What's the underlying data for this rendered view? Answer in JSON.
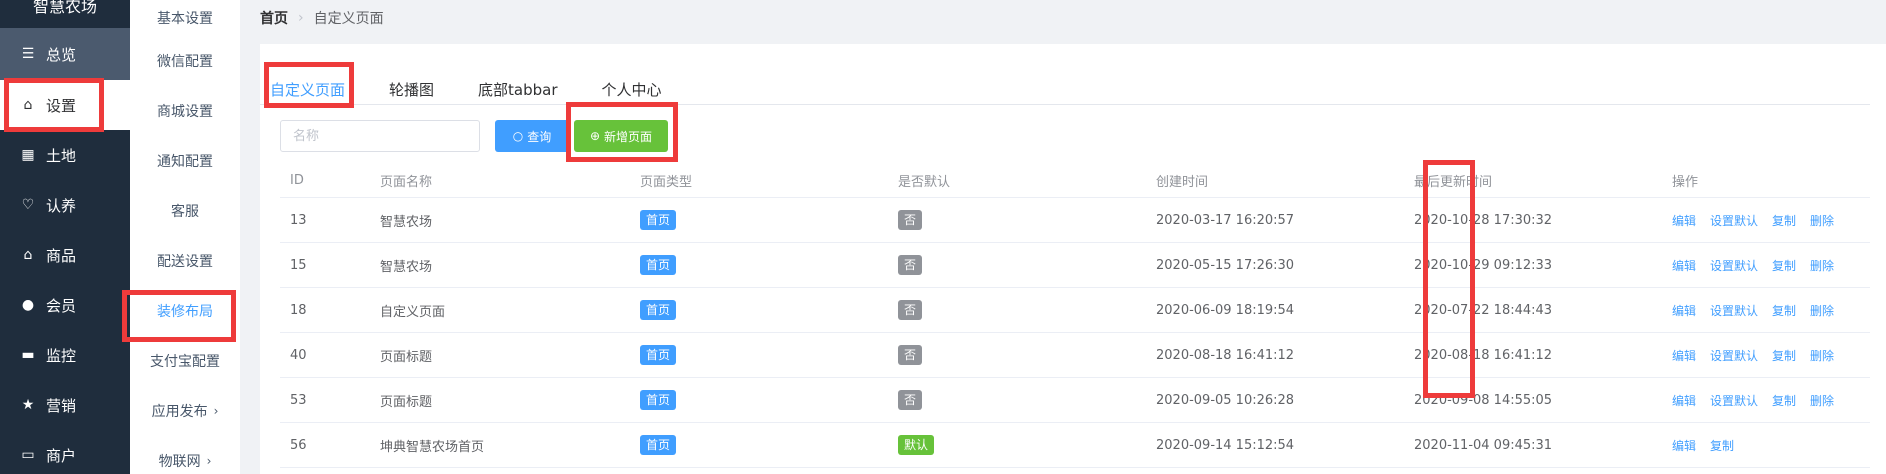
{
  "sidebar": {
    "brand": "智慧农场",
    "items": [
      {
        "label": "总览",
        "icon": "sliders-icon"
      },
      {
        "label": "设置",
        "icon": "bag-icon"
      },
      {
        "label": "土地",
        "icon": "grid-icon"
      },
      {
        "label": "认养",
        "icon": "heart-icon"
      },
      {
        "label": "商品",
        "icon": "bag-icon"
      },
      {
        "label": "会员",
        "icon": "user-icon"
      },
      {
        "label": "监控",
        "icon": "camera-icon"
      },
      {
        "label": "营销",
        "icon": "star-icon"
      },
      {
        "label": "商户",
        "icon": "car-icon"
      }
    ]
  },
  "subnav": {
    "items": [
      {
        "label": "基本设置"
      },
      {
        "label": "微信配置"
      },
      {
        "label": "商城设置"
      },
      {
        "label": "通知配置"
      },
      {
        "label": "客服"
      },
      {
        "label": "配送设置"
      },
      {
        "label": "装修布局"
      },
      {
        "label": "支付宝配置"
      },
      {
        "label": "应用发布"
      },
      {
        "label": "物联网"
      }
    ]
  },
  "breadcrumb": {
    "home": "首页",
    "current": "自定义页面"
  },
  "tabs": [
    {
      "label": "自定义页面"
    },
    {
      "label": "轮播图"
    },
    {
      "label": "底部tabbar"
    },
    {
      "label": "个人中心"
    }
  ],
  "search": {
    "placeholder": "名称",
    "query_label": "查询",
    "add_label": "新增页面"
  },
  "table": {
    "headers": [
      "ID",
      "页面名称",
      "页面类型",
      "是否默认",
      "创建时间",
      "最后更新时间",
      "操作"
    ],
    "rows": [
      {
        "id": "13",
        "name": "智慧农场",
        "type": "首页",
        "default": "否",
        "created": "2020-03-17 16:20:57",
        "updated": "2020-10-28 17:30:32",
        "ops": [
          "编辑",
          "设置默认",
          "复制",
          "删除"
        ]
      },
      {
        "id": "15",
        "name": "智慧农场",
        "type": "首页",
        "default": "否",
        "created": "2020-05-15 17:26:30",
        "updated": "2020-10-29 09:12:33",
        "ops": [
          "编辑",
          "设置默认",
          "复制",
          "删除"
        ]
      },
      {
        "id": "18",
        "name": "自定义页面",
        "type": "首页",
        "default": "否",
        "created": "2020-06-09 18:19:54",
        "updated": "2020-07-22 18:44:43",
        "ops": [
          "编辑",
          "设置默认",
          "复制",
          "删除"
        ]
      },
      {
        "id": "40",
        "name": "页面标题",
        "type": "首页",
        "default": "否",
        "created": "2020-08-18 16:41:12",
        "updated": "2020-08-18 16:41:12",
        "ops": [
          "编辑",
          "设置默认",
          "复制",
          "删除"
        ]
      },
      {
        "id": "53",
        "name": "页面标题",
        "type": "首页",
        "default": "否",
        "created": "2020-09-05 10:26:28",
        "updated": "2020-09-08 14:55:05",
        "ops": [
          "编辑",
          "设置默认",
          "复制",
          "删除"
        ]
      },
      {
        "id": "56",
        "name": "坤典智慧农场首页",
        "type": "首页",
        "default": "默认",
        "created": "2020-09-14 15:12:54",
        "updated": "2020-11-04 09:45:31",
        "ops": [
          "编辑",
          "复制"
        ]
      }
    ]
  },
  "colors": {
    "accent": "#409eff",
    "success": "#67c23a",
    "sidebar": "#1f2d3d",
    "highlight": "#ee3b3b"
  }
}
